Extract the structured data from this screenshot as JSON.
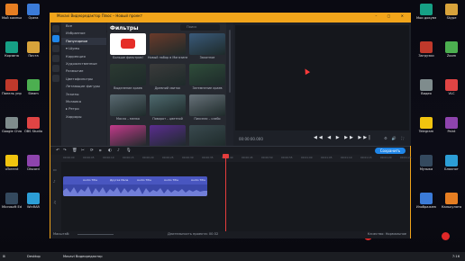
{
  "window": {
    "title": "Movavi Видеоредактор Плюс – Новый проект",
    "controls": "– ▢ ✕"
  },
  "menu": [
    "Файл",
    "Редактирование",
    "Воспроизведение",
    "Настройки",
    "Экспорт",
    "Справка"
  ],
  "categories": [
    {
      "label": "Все",
      "selected": false
    },
    {
      "label": "Избранное",
      "selected": false
    },
    {
      "label": "Популярное",
      "selected": true
    },
    {
      "label": "▾ Шумы",
      "selected": false
    },
    {
      "label": "Коррекция",
      "selected": false
    },
    {
      "label": "Художественные",
      "selected": false
    },
    {
      "label": "Размытие",
      "selected": false
    },
    {
      "label": "Цветофильтры",
      "selected": false
    },
    {
      "label": "Летающие фигуры",
      "selected": false
    },
    {
      "label": "Эскизы",
      "selected": false
    },
    {
      "label": "Мозаика",
      "selected": false
    },
    {
      "label": "▸ Ретро",
      "selected": false
    },
    {
      "label": "Хорроры",
      "selected": false
    }
  ],
  "filters_panel": {
    "heading": "Фильтры",
    "search_placeholder": "Поиск",
    "items": [
      {
        "label": "Больше фильтров!",
        "color": "#ffffff"
      },
      {
        "label": "Новый набор в Магазине эффектов",
        "color": "#6a3a2a"
      },
      {
        "label": "Закатное",
        "color": "#3a5a7a"
      },
      {
        "label": "Выделение краев",
        "color": "#2c3a32"
      },
      {
        "label": "Древний свиток",
        "color": "#3b3b3b"
      },
      {
        "label": "Затемнение краев",
        "color": "#2f4d3a"
      },
      {
        "label": "Масло – мелко",
        "color": "#5a6a72"
      },
      {
        "label": "Поворот – цветной",
        "color": "#4f6a6f"
      },
      {
        "label": "Пиксели – слабо",
        "color": "#68727a"
      },
      {
        "label": "",
        "color": "#c23a8a"
      },
      {
        "label": "",
        "color": "#5a2c8f"
      },
      {
        "label": "",
        "color": "#3a4a4f"
      }
    ]
  },
  "preview": {
    "timecode": "00:00:00.000",
    "playback_controls": "◀◀ ◀ ▶ ▶▶ ▶▶|",
    "right_controls": "⚙ 🔊 ⛶"
  },
  "timeline": {
    "export_label": "Сохранить",
    "ruler": [
      "00:00:00",
      "00:00:05",
      "00:00:10",
      "00:00:15",
      "00:00:20",
      "00:00:25",
      "00:00:30",
      "00:00:35",
      "00:00:40",
      "00:00:45",
      "00:00:50",
      "00:00:55",
      "00:01:00",
      "00:01:05",
      "00:01:10",
      "00:01:15",
      "00:01:20",
      "00:01:25"
    ],
    "clip_labels": [
      "Audio Title",
      "Другая Мела",
      "Audio Title",
      "Audio Title",
      "Audio Title"
    ],
    "scale_label": "Масштаб:",
    "duration": "Длительность проекта: 00:32",
    "quality": "Качество: Нормальное"
  },
  "desktop_icons_left": [
    "Мой компьютер",
    "Корзина",
    "Панель управления",
    "Google Chrome",
    "uTorrent",
    "Microsoft Edge",
    "Opera",
    "Почта",
    "Steam",
    "OBS Studio",
    "Discord",
    "WinRAR"
  ],
  "desktop_icons_right": [
    "Мои документы",
    "Загрузки",
    "Видео",
    "Telegram",
    "Музыка",
    "Изображения",
    "Skype",
    "Zoom",
    "VLC",
    "Paint",
    "Блокнот",
    "Калькулятор"
  ],
  "taskbar": {
    "items": [
      "Desktop",
      "Movavi Видеоредактор"
    ],
    "clock": "7:16"
  }
}
